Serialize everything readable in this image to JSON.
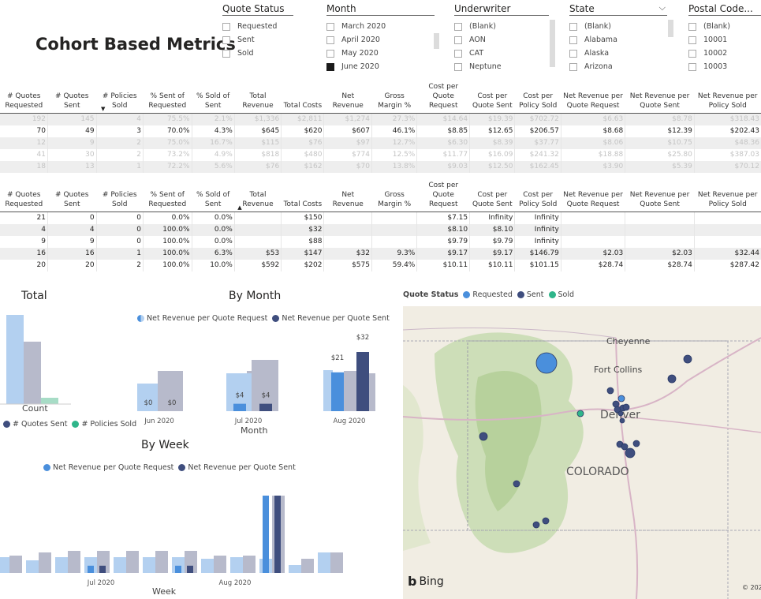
{
  "title": "Cohort Based Metrics",
  "slicers": {
    "quote_status": {
      "label": "Quote Status",
      "items": [
        "Requested",
        "Sent",
        "Sold"
      ]
    },
    "month": {
      "label": "Month",
      "items": [
        "March 2020",
        "April 2020",
        "May 2020",
        "June 2020"
      ],
      "checked": "June 2020"
    },
    "underwriter": {
      "label": "Underwriter",
      "items": [
        "(Blank)",
        "AON",
        "CAT",
        "Neptune"
      ]
    },
    "state": {
      "label": "State",
      "items": [
        "(Blank)",
        "Alabama",
        "Alaska",
        "Arizona"
      ]
    },
    "postal": {
      "label": "Postal Code...",
      "items": [
        "(Blank)",
        "10001",
        "10002",
        "10003"
      ]
    }
  },
  "table_headers": [
    "# Quotes Requested",
    "# Quotes Sent",
    "# Policies Sold",
    "% Sent of Requested",
    "% Sold of Sent",
    "Total Revenue",
    "Total Costs",
    "Net Revenue",
    "Gross Margin %",
    "Cost per Quote Request",
    "Cost per Quote Sent",
    "Cost per Policy Sold",
    "Net Revenue per Quote Request",
    "Net Revenue per Quote Sent",
    "Net Revenue per Policy Sold"
  ],
  "table1_rows": [
    [
      "192",
      "145",
      "4",
      "75.5%",
      "2.1%",
      "$1,336",
      "$2,811",
      "$1,274",
      "27.3%",
      "$14.64",
      "$19.39",
      "$702.72",
      "$6.63",
      "$8.78",
      "$318.43"
    ],
    [
      "70",
      "49",
      "3",
      "70.0%",
      "4.3%",
      "$645",
      "$620",
      "$607",
      "46.1%",
      "$8.85",
      "$12.65",
      "$206.57",
      "$8.68",
      "$12.39",
      "$202.43"
    ],
    [
      "12",
      "9",
      "2",
      "75.0%",
      "16.7%",
      "$115",
      "$76",
      "$97",
      "12.7%",
      "$6.30",
      "$8.39",
      "$37.77",
      "$8.06",
      "$10.75",
      "$48.36"
    ],
    [
      "41",
      "30",
      "2",
      "73.2%",
      "4.9%",
      "$818",
      "$480",
      "$774",
      "12.5%",
      "$11.77",
      "$16.09",
      "$241.32",
      "$18.88",
      "$25.80",
      "$387.03"
    ],
    [
      "18",
      "13",
      "1",
      "72.2%",
      "5.6%",
      "$76",
      "$162",
      "$70",
      "13.8%",
      "$9.03",
      "$12.50",
      "$162.45",
      "$3.90",
      "$5.39",
      "$70.12"
    ]
  ],
  "table2_rows": [
    [
      "21",
      "0",
      "0",
      "0.0%",
      "0.0%",
      "",
      "$150",
      "",
      "",
      "$7.15",
      "Infinity",
      "Infinity",
      "",
      "",
      ""
    ],
    [
      "4",
      "4",
      "0",
      "100.0%",
      "0.0%",
      "",
      "$32",
      "",
      "",
      "$8.10",
      "$8.10",
      "Infinity",
      "",
      "",
      ""
    ],
    [
      "9",
      "9",
      "0",
      "100.0%",
      "0.0%",
      "",
      "$88",
      "",
      "",
      "$9.79",
      "$9.79",
      "Infinity",
      "",
      "",
      ""
    ],
    [
      "16",
      "16",
      "1",
      "100.0%",
      "6.3%",
      "$53",
      "$147",
      "$32",
      "9.3%",
      "$9.17",
      "$9.17",
      "$146.79",
      "$2.03",
      "$2.03",
      "$32.44"
    ],
    [
      "20",
      "20",
      "2",
      "100.0%",
      "10.0%",
      "$592",
      "$202",
      "$575",
      "59.4%",
      "$10.11",
      "$10.11",
      "$101.15",
      "$28.74",
      "$28.74",
      "$287.42"
    ]
  ],
  "total_chart": {
    "title": "Total",
    "xlabel": "Count",
    "legend": [
      "# Quotes Sent",
      "# Policies Sold"
    ]
  },
  "by_month": {
    "title": "By Month",
    "legend": [
      "Net Revenue per Quote Request",
      "Net Revenue per Quote Sent"
    ],
    "xlabel": "Month",
    "categories": [
      "Jun 2020",
      "Jul 2020",
      "Aug 2020"
    ],
    "labels": [
      [
        "$0",
        "$0"
      ],
      [
        "$4",
        "$4"
      ],
      [
        "$21",
        "$32"
      ]
    ]
  },
  "by_week": {
    "title": "By Week",
    "legend": [
      "Net Revenue per Quote Request",
      "Net Revenue per Quote Sent"
    ],
    "xlabel": "Week",
    "ticks": [
      "Jul 2020",
      "Aug 2020"
    ]
  },
  "map": {
    "legend_title": "Quote Status",
    "legend": [
      "Requested",
      "Sent",
      "Sold"
    ],
    "labels": {
      "cheyenne": "Cheyenne",
      "fort_collins": "Fort Collins",
      "denver": "Denver",
      "colorado": "COLORADO"
    },
    "bing": "Bing",
    "copyright": "© 2020"
  },
  "colors": {
    "requested": "#4a8fdc",
    "sent": "#3f4e7e",
    "sold": "#2fb58a",
    "light_blue": "#b3d0f0",
    "light_gray": "#b7bacb"
  },
  "chart_data": [
    {
      "type": "bar",
      "title": "Total",
      "xlabel": "Count",
      "series": [
        {
          "name": "# Quotes Requested",
          "values": [
            70
          ]
        },
        {
          "name": "# Quotes Sent",
          "values": [
            49
          ]
        },
        {
          "name": "# Policies Sold",
          "values": [
            3
          ]
        }
      ]
    },
    {
      "type": "bar",
      "title": "By Month",
      "xlabel": "Month",
      "categories": [
        "Jun 2020",
        "Jul 2020",
        "Aug 2020"
      ],
      "series": [
        {
          "name": "Net Revenue per Quote Request",
          "values": [
            0,
            4,
            21
          ]
        },
        {
          "name": "Net Revenue per Quote Sent",
          "values": [
            0,
            4,
            32
          ]
        }
      ]
    },
    {
      "type": "bar",
      "title": "By Week",
      "xlabel": "Week",
      "ticks": [
        "Jul 2020",
        "Aug 2020"
      ],
      "series": [
        {
          "name": "Net Revenue per Quote Request",
          "values": [
            0,
            0,
            0,
            3,
            0,
            0,
            3,
            0,
            0,
            32,
            0,
            0
          ]
        },
        {
          "name": "Net Revenue per Quote Sent",
          "values": [
            0,
            0,
            0,
            3,
            0,
            0,
            3,
            0,
            0,
            32,
            0,
            0
          ]
        }
      ]
    }
  ]
}
